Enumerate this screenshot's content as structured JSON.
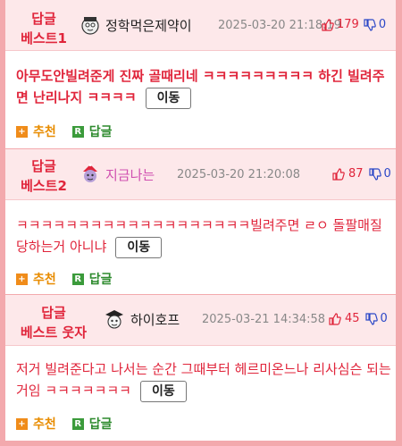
{
  "comments": [
    {
      "badge_line1": "답글",
      "badge_line2": "베스트1",
      "nickname": "정학먹은제약이",
      "date": "2025-03-20 21:18:19",
      "up": "179",
      "down": "0",
      "text": "아무도안빌려준게 진짜 골때리네 ㅋㅋㅋㅋㅋㅋㅋㅋㅋ 하긴 빌려주면 난리나지 ㅋㅋㅋㅋ",
      "move_label": "이동",
      "recommend_label": "추천",
      "reply_label": "답글"
    },
    {
      "badge_line1": "답글",
      "badge_line2": "베스트2",
      "nickname": "지금나는",
      "date": "2025-03-20 21:20:08",
      "up": "87",
      "down": "0",
      "text": "ㅋㅋㅋㅋㅋㅋㅋㅋㅋㅋㅋㅋㅋㅋㅋㅋㅋㅋㅋ빌려주면 ㄹㅇ 돌팔매질 당하는거 아니냐",
      "move_label": "이동",
      "recommend_label": "추천",
      "reply_label": "답글"
    },
    {
      "badge_line1": "답글",
      "badge_line2": "베스트 웃자",
      "nickname": "하이호프",
      "date": "2025-03-21 14:34:58",
      "up": "45",
      "down": "0",
      "text": "저거 빌려준다고 나서는 순간 그때부터 헤르미온느나 리사심슨 되는거임 ㅋㅋㅋㅋㅋㅋㅋ",
      "move_label": "이동",
      "recommend_label": "추천",
      "reply_label": "답글"
    }
  ],
  "icons": {
    "recommend": "plus-square-icon",
    "reply": "reply-square-icon",
    "thumb_up": "thumbs-up-icon",
    "thumb_down": "thumbs-down-icon"
  },
  "colors": {
    "accent_red": "#e0253b",
    "down_blue": "#2b47c7",
    "header_pink": "#fde8ea",
    "border_pink": "#f3a9ad",
    "recommend_orange": "#f08c1a",
    "reply_green": "#3b9b3b"
  }
}
